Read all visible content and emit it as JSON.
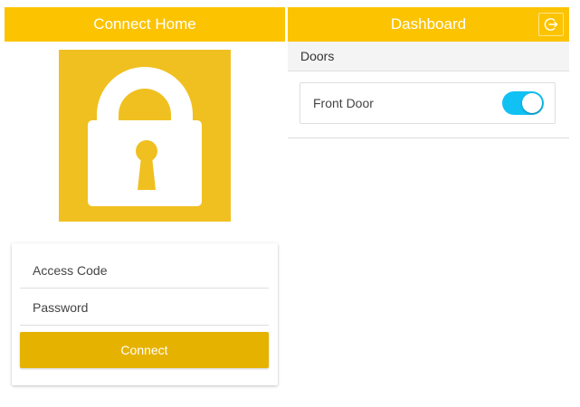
{
  "login_screen": {
    "title": "Connect Home",
    "access_code_placeholder": "Access Code",
    "password_placeholder": "Password",
    "connect_label": "Connect",
    "lock_icon": "padlock-icon"
  },
  "dashboard_screen": {
    "title": "Dashboard",
    "logout_icon": "logout-icon",
    "section_title": "Doors",
    "doors": [
      {
        "label": "Front Door",
        "enabled": true
      }
    ]
  },
  "colors": {
    "brand_yellow": "#fcc300",
    "lock_tile": "#f0c020",
    "button_yellow": "#e6b200",
    "toggle_on": "#11c1f3"
  }
}
